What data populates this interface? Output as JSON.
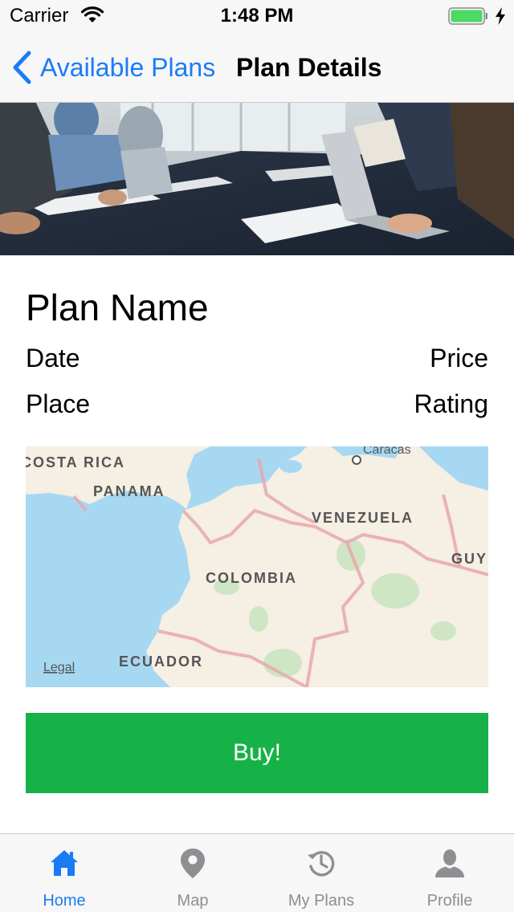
{
  "status_bar": {
    "carrier": "Carrier",
    "time": "1:48 PM"
  },
  "nav": {
    "back_label": "Available Plans",
    "title": "Plan Details"
  },
  "plan": {
    "name": "Plan Name",
    "date": "Date",
    "price": "Price",
    "place": "Place",
    "rating": "Rating"
  },
  "map": {
    "labels": {
      "costa_rica": "COSTA RICA",
      "panama": "PANAMA",
      "venezuela": "VENEZUELA",
      "colombia": "COLOMBIA",
      "ecuador": "ECUADOR",
      "caracas": "Caracas",
      "guyana_partial": "GUY",
      "legal": "Legal"
    }
  },
  "buy_label": "Buy!",
  "tabs": [
    {
      "label": "Home",
      "icon": "home-icon",
      "active": true
    },
    {
      "label": "Map",
      "icon": "map-pin-icon",
      "active": false
    },
    {
      "label": "My Plans",
      "icon": "history-icon",
      "active": false
    },
    {
      "label": "Profile",
      "icon": "person-icon",
      "active": false
    }
  ],
  "colors": {
    "accent": "#1a7cf5",
    "buy_button": "#17b247",
    "tab_inactive": "#8e8e93",
    "battery": "#4cd964"
  }
}
